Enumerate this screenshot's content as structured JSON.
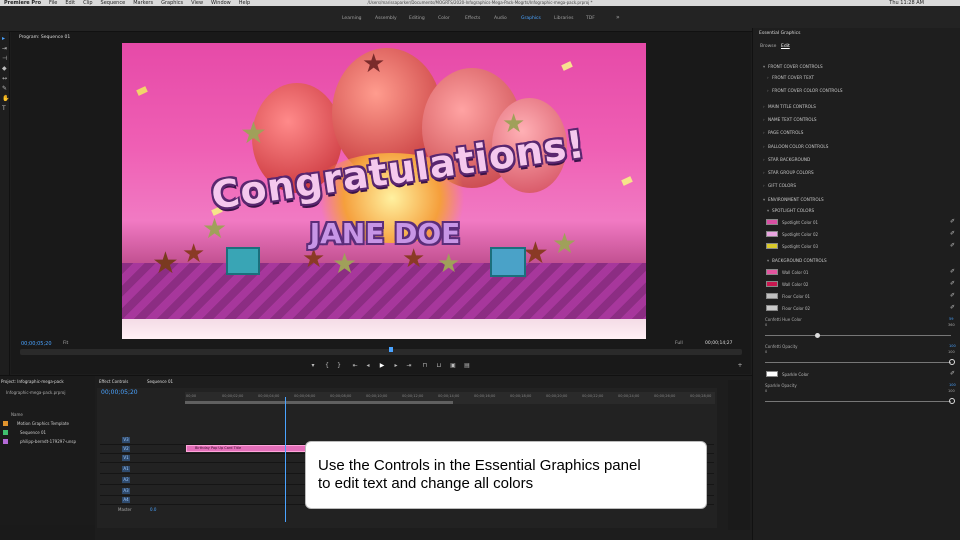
{
  "menubar": {
    "app": "Premiere Pro",
    "items": [
      "File",
      "Edit",
      "Clip",
      "Sequence",
      "Markers",
      "Graphics",
      "View",
      "Window",
      "Help"
    ],
    "path": "/Users/marissaparker/Documents/MOGRTS/2020-Infographics-Mega-Pack-Mogrts/Infographic-mega-pack.prproj *",
    "clock": "Thu 11:28 AM"
  },
  "workspaces": [
    "Learning",
    "Assembly",
    "Editing",
    "Color",
    "Effects",
    "Audio",
    "Graphics",
    "Libraries",
    "TDF"
  ],
  "active_workspace": "Graphics",
  "program": {
    "title": "Program: Sequence 01",
    "timecode_current": "00;00;05;20",
    "fit": "Fit",
    "quality": "Full",
    "timecode_duration": "00;00;14;27"
  },
  "video": {
    "headline": "Congratulations!",
    "name": "JANE DOE"
  },
  "essential_graphics": {
    "title": "Essential Graphics",
    "tabs": [
      "Browse",
      "Edit"
    ],
    "active_tab": "Edit",
    "sections": [
      "FRONT COVER CONTROLS",
      "FRONT COVER TEXT",
      "FRONT COVER COLOR CONTROLS",
      "MAIN TITLE CONTROLS",
      "NAME TEXT CONTROLS",
      "PAGE CONTROLS",
      "BALLOON COLOR CONTROLS",
      "STAR BACKGROUND",
      "STAR GROUP COLORS",
      "GIFT COLORS",
      "ENVIRONMENT CONTROLS",
      "SPOTLIGHT COLORS"
    ],
    "spotlight_colors": [
      {
        "label": "Spotlight Color 01",
        "color": "#d84fa3"
      },
      {
        "label": "Spotlight Color 02",
        "color": "#e9a5e0"
      },
      {
        "label": "Spotlight Color 03",
        "color": "#d9c92a"
      }
    ],
    "background_section": "BACKGROUND CONTROLS",
    "background_colors": [
      {
        "label": "Wall Color 01",
        "color": "#e2559f"
      },
      {
        "label": "Wall Color 02",
        "color": "#c8174f"
      },
      {
        "label": "Floor Color 01",
        "color": "#bfbfbf"
      },
      {
        "label": "Floor Color 02",
        "color": "#c9c9c9"
      }
    ],
    "confetti_hue_label": "Confetti Hue Color",
    "confetti_hue_min": "0",
    "confetti_hue_max": "360",
    "confetti_hue_val": "59",
    "confetti_hue_value": 0.28,
    "confetti_opacity_label": "Confetti Opacity",
    "confetti_opacity_min": "0",
    "confetti_opacity_max": "100",
    "confetti_opacity_val": "100",
    "sparkle_color_label": "Sparkle Color",
    "sparkle_opacity_label": "Sparkle Opacity",
    "sparkle_opacity_min": "0",
    "sparkle_opacity_max": "100",
    "sparkle_opacity_val": "100"
  },
  "project": {
    "tabs": [
      "Project: Infographic-mega-pack",
      "Effect Controls",
      "Sequence 01"
    ],
    "file": "Infographic-mega-pack.prproj",
    "name_header": "Name",
    "items": [
      {
        "label": "Motion Graphics Template",
        "color": "#e0942e"
      },
      {
        "label": "Sequence 01",
        "color": "#3fbf6e"
      },
      {
        "label": "philipp-berndt-179297-unsp",
        "color": "#b56ad8"
      }
    ]
  },
  "timeline": {
    "timecode": "00;00;05;20",
    "ruler": [
      "00;00",
      "00;00;02;00",
      "00;00;04;00",
      "00;00;06;00",
      "00;00;08;00",
      "00;00;10;00",
      "00;00;12;00",
      "00;00;14;00",
      "00;00;16;00",
      "00;00;18;00",
      "00;00;20;00",
      "00;00;22;00",
      "00;00;24;00",
      "00;00;26;00",
      "00;00;28;00"
    ],
    "tracks": [
      "V3",
      "V2",
      "V1",
      "A1",
      "A2",
      "A3",
      "A4"
    ],
    "clip_label": "Birthday Pop Up Card Title",
    "master_label": "Master",
    "master_val": "0.0"
  },
  "callout": {
    "line1": "Use the Controls in the Essential Graphics panel",
    "line2": "to edit text and change all colors"
  }
}
